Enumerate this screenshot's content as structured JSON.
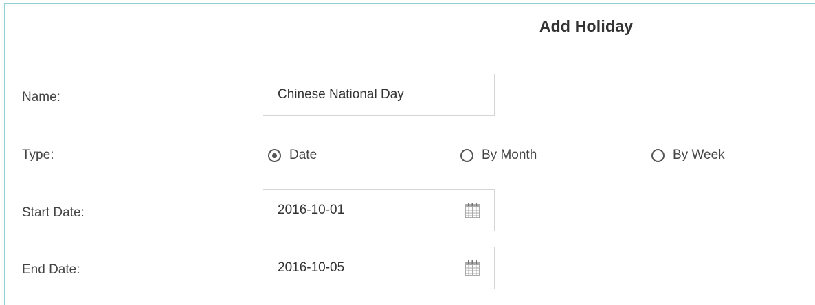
{
  "dialog": {
    "title": "Add Holiday"
  },
  "form": {
    "name": {
      "label": "Name:",
      "value": "Chinese National Day"
    },
    "type": {
      "label": "Type:",
      "options": [
        {
          "label": "Date",
          "checked": true
        },
        {
          "label": "By Month",
          "checked": false
        },
        {
          "label": "By Week",
          "checked": false
        }
      ]
    },
    "start_date": {
      "label": "Start Date:",
      "value": "2016-10-01",
      "icon": "calendar-icon"
    },
    "end_date": {
      "label": "End Date:",
      "value": "2016-10-05",
      "icon": "calendar-icon"
    }
  },
  "colors": {
    "dialog_border": "#8fd0d6",
    "field_border": "#d4d4d4",
    "text": "#333333"
  }
}
